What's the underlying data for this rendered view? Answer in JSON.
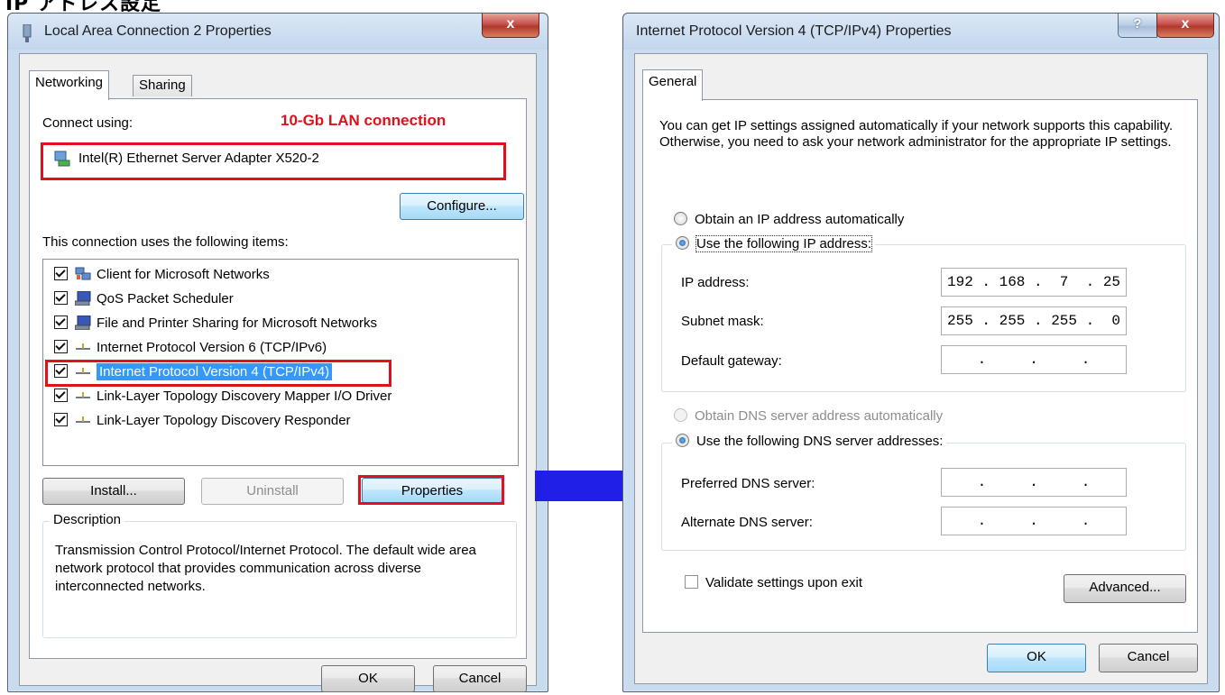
{
  "page_title": "IP アドレス設定",
  "annotation": "10-Gb LAN connection",
  "colors": {
    "highlight_red": "#e0101c",
    "arrow_blue": "#1f1fe8",
    "selection_blue": "#3399ff"
  },
  "left_dialog": {
    "title": "Local Area Connection 2 Properties",
    "close_label": "x",
    "tabs": [
      "Networking",
      "Sharing"
    ],
    "connect_using_label": "Connect using:",
    "adapter_name": "Intel(R) Ethernet Server Adapter X520-2",
    "configure_label": "Configure...",
    "items_label": "This connection uses the following items:",
    "items": [
      {
        "label": "Client for Microsoft Networks",
        "checked": true,
        "icon": "network-client-icon"
      },
      {
        "label": "QoS Packet Scheduler",
        "checked": true,
        "icon": "computer-service-icon"
      },
      {
        "label": "File and Printer Sharing for Microsoft Networks",
        "checked": true,
        "icon": "computer-service-icon"
      },
      {
        "label": "Internet Protocol Version 6 (TCP/IPv6)",
        "checked": true,
        "icon": "protocol-icon"
      },
      {
        "label": "Internet Protocol Version 4 (TCP/IPv4)",
        "checked": true,
        "icon": "protocol-icon",
        "selected": true
      },
      {
        "label": "Link-Layer Topology Discovery Mapper I/O Driver",
        "checked": true,
        "icon": "protocol-icon"
      },
      {
        "label": "Link-Layer Topology Discovery Responder",
        "checked": true,
        "icon": "protocol-icon"
      }
    ],
    "install_label": "Install...",
    "uninstall_label": "Uninstall",
    "properties_label": "Properties",
    "description_title": "Description",
    "description_text": "Transmission Control Protocol/Internet Protocol. The default wide area network protocol that provides communication across diverse interconnected networks.",
    "ok_label": "OK",
    "cancel_label": "Cancel"
  },
  "right_dialog": {
    "title": "Internet Protocol Version 4 (TCP/IPv4) Properties",
    "help_label": "?",
    "close_label": "x",
    "tab": "General",
    "intro_text": "You can get IP settings assigned automatically if your network supports this capability. Otherwise, you need to ask your network administrator for the appropriate IP settings.",
    "obtain_ip_auto": "Obtain an IP address automatically",
    "use_following_ip": "Use the following IP address:",
    "ip_address_label": "IP address:",
    "ip_address_value": "192 . 168 .  7  . 25",
    "subnet_mask_label": "Subnet mask:",
    "subnet_mask_value": "255 . 255 . 255 .  0",
    "gateway_label": "Default gateway:",
    "gateway_value": ".     .     .",
    "obtain_dns_auto": "Obtain DNS server address automatically",
    "use_following_dns": "Use the following DNS server addresses:",
    "preferred_dns_label": "Preferred DNS server:",
    "preferred_dns_value": ".     .     .",
    "alternate_dns_label": "Alternate DNS server:",
    "alternate_dns_value": ".     .     .",
    "validate_label": "Validate settings upon exit",
    "advanced_label": "Advanced...",
    "ok_label": "OK",
    "cancel_label": "Cancel"
  }
}
